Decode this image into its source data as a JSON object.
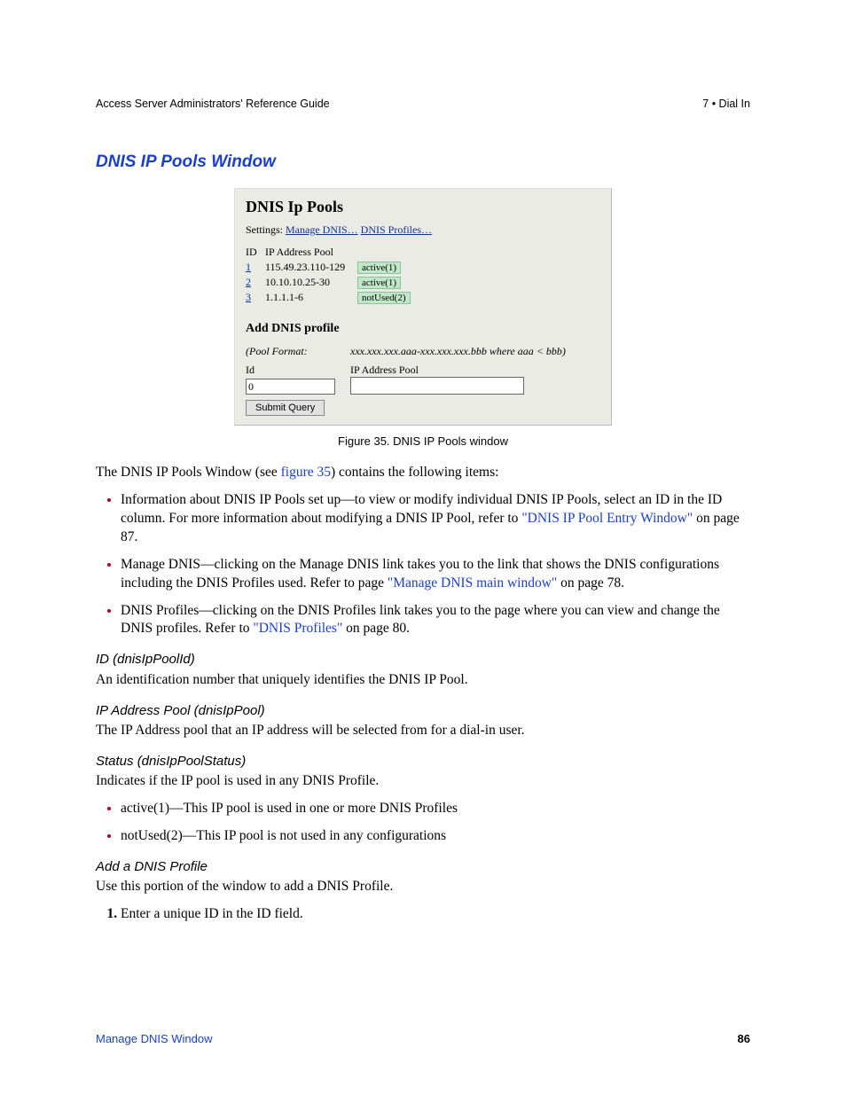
{
  "header": {
    "left": "Access Server Administrators' Reference Guide",
    "right": "7 • Dial In"
  },
  "heading": "DNIS IP Pools Window",
  "figure": {
    "title": "DNIS Ip Pools",
    "settings_label": "Settings:",
    "manage_link": "Manage DNIS…",
    "profiles_link": "DNIS Profiles…",
    "table_hdr_id": "ID",
    "table_hdr_pool": "IP Address Pool",
    "rows": [
      {
        "id": "1",
        "pool": "115.49.23.110-129",
        "status": "active(1)"
      },
      {
        "id": "2",
        "pool": "10.10.10.25-30",
        "status": "active(1)"
      },
      {
        "id": "3",
        "pool": "1.1.1.1-6",
        "status": "notUsed(2)"
      }
    ],
    "add_heading": "Add DNIS profile",
    "format_label": "(Pool Format:",
    "format_value": "xxx.xxx.xxx.aaa-xxx.xxx.xxx.bbb where aaa < bbb)",
    "input_id_label": "Id",
    "input_pool_label": "IP Address Pool",
    "input_id_value": "0",
    "submit_label": "Submit Query"
  },
  "caption": "Figure 35. DNIS IP Pools window",
  "intro": {
    "pre": "The DNIS IP Pools Window (see ",
    "link": "figure 35",
    "post": ") contains the following items:"
  },
  "bullets": {
    "b1_pre": "Information about DNIS IP Pools set up—to view or modify individual DNIS IP Pools, select an ID in the ID column. For more information about modifying a DNIS IP Pool, refer to ",
    "b1_link": "\"DNIS IP Pool Entry Window\"",
    "b1_post": " on page 87.",
    "b2_pre": "Manage DNIS—clicking on the Manage DNIS link takes you to the link that shows the DNIS configurations including the DNIS Profiles used. Refer to page ",
    "b2_link": "\"Manage DNIS main window\"",
    "b2_post": " on page 78.",
    "b3_pre": "DNIS Profiles—clicking on the DNIS Profiles link takes you to the page where you can view and change the DNIS profiles. Refer to ",
    "b3_link": "\"DNIS Profiles\"",
    "b3_post": " on page 80."
  },
  "sections": {
    "s1_h": "ID (dnisIpPoolId)",
    "s1_t": "An identification number that uniquely identifies the DNIS IP Pool.",
    "s2_h": "IP Address Pool (dnisIpPool)",
    "s2_t": "The IP Address pool that an IP address will be selected from for a dial-in user.",
    "s3_h": "Status (dnisIpPoolStatus)",
    "s3_t": "Indicates if the IP pool is used in any DNIS Profile.",
    "s3_b1": "active(1)—This IP pool is used in one or more DNIS Profiles",
    "s3_b2": "notUsed(2)—This IP pool is not used in any configurations",
    "s4_h": "Add a DNIS Profile",
    "s4_t": "Use this portion of the window to add a DNIS Profile.",
    "s4_step1": "Enter a unique ID in the ID field."
  },
  "footer": {
    "left": "Manage DNIS Window",
    "page": "86"
  }
}
